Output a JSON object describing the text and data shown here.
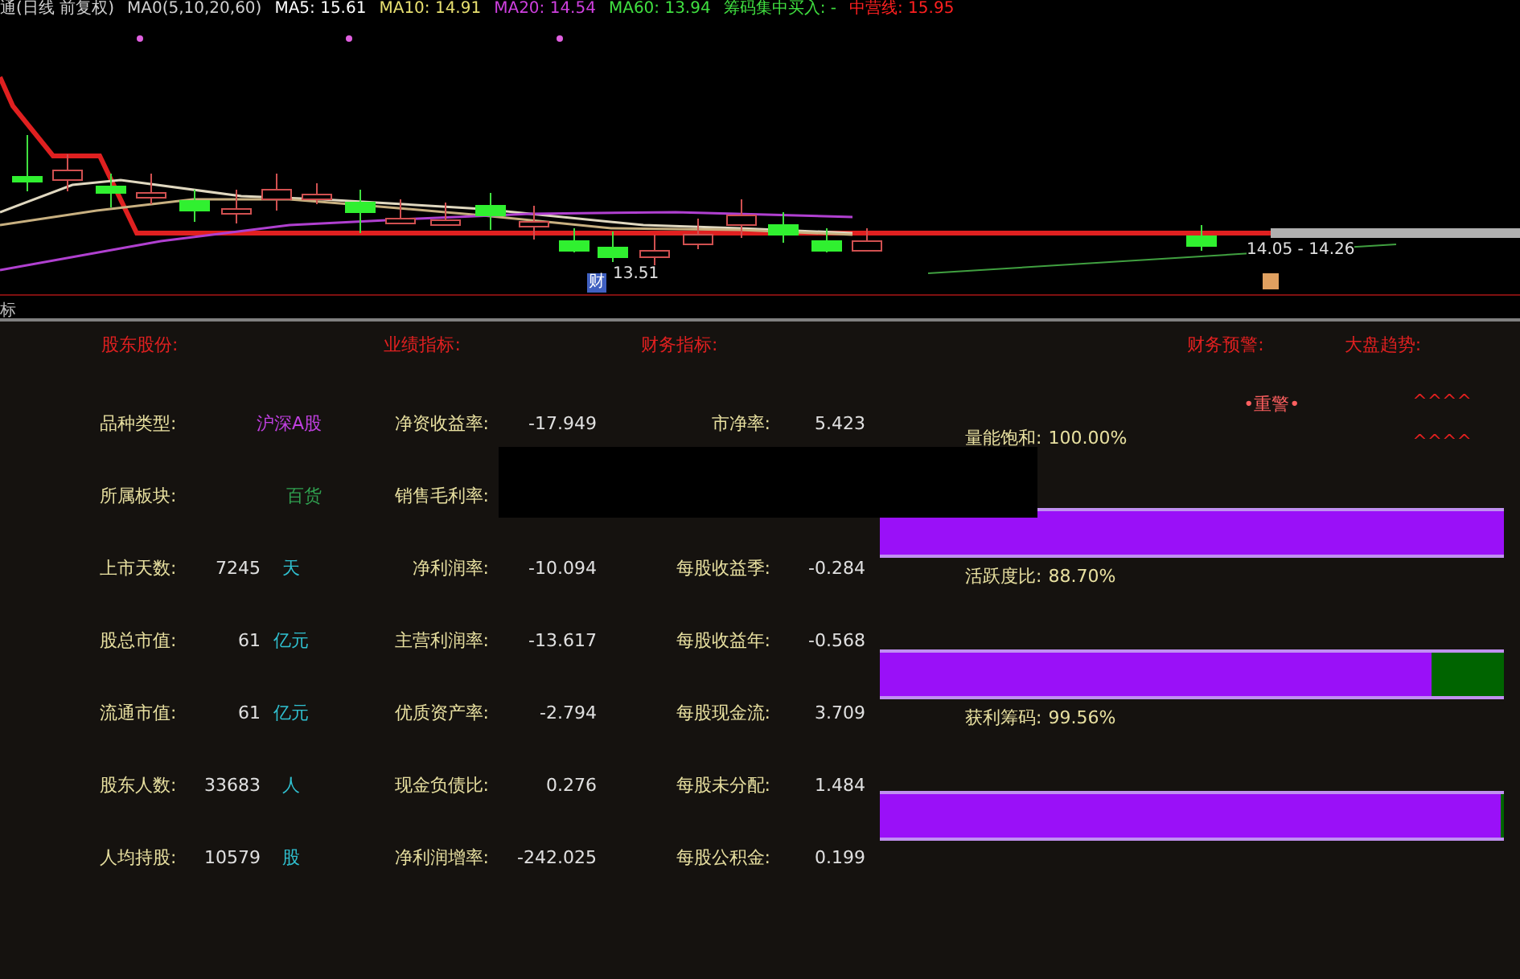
{
  "chart_header": {
    "title": "通(日线 前复权)",
    "indicator": "MA0(5,10,20,60)",
    "items": [
      {
        "text": "MA5: 15.61",
        "color": "#ffffff"
      },
      {
        "text": "MA10: 14.91",
        "color": "#e8e070"
      },
      {
        "text": "MA20: 14.54",
        "color": "#d040e0"
      },
      {
        "text": "MA60: 13.94",
        "color": "#40e040"
      },
      {
        "text": "筹码集中买入: -",
        "color": "#40e040"
      },
      {
        "text": "中营线: 15.95",
        "color": "#ff2020"
      }
    ]
  },
  "chart": {
    "low_label": "13.51",
    "range_label": "14.05 - 14.26",
    "marker": "财"
  },
  "lower_tab": "标",
  "headers": [
    {
      "text": "股东股份:"
    },
    {
      "text": "业绩指标:"
    },
    {
      "text": "财务指标:"
    },
    {
      "text": "财务预警:"
    },
    {
      "text": "大盘趋势:"
    }
  ],
  "rows": [
    {
      "basic": {
        "label": "品种类型:",
        "value": "沪深A股",
        "color": "#c040e0"
      },
      "performance": {
        "label": "净资收益率:",
        "value": "-17.949"
      },
      "finance": {
        "label": "市净率:",
        "value": "5.423"
      }
    },
    {
      "basic": {
        "label": "所属板块:",
        "value": "百货",
        "color": "#30a050"
      },
      "performance": {
        "label": "销售毛利率:"
      }
    },
    {
      "basic": {
        "label": "上市天数:",
        "value": "7245",
        "unit": "天"
      },
      "performance": {
        "label": "净利润率:",
        "value": "-10.094"
      },
      "finance": {
        "label": "每股收益季:",
        "value": "-0.284"
      }
    },
    {
      "basic": {
        "label": "股总市值:",
        "value": "61",
        "unit": "亿元"
      },
      "performance": {
        "label": "主营利润率:",
        "value": "-13.617"
      },
      "finance": {
        "label": "每股收益年:",
        "value": "-0.568"
      }
    },
    {
      "basic": {
        "label": "流通市值:",
        "value": "61",
        "unit": "亿元"
      },
      "performance": {
        "label": "优质资产率:",
        "value": "-2.794"
      },
      "finance": {
        "label": "每股现金流:",
        "value": "3.709"
      }
    },
    {
      "basic": {
        "label": "股东人数:",
        "value": "33683",
        "unit": "人"
      },
      "performance": {
        "label": "现金负债比:",
        "value": "0.276"
      },
      "finance": {
        "label": "每股未分配:",
        "value": "1.484"
      }
    },
    {
      "basic": {
        "label": "人均持股:",
        "value": "10579",
        "unit": "股"
      },
      "performance": {
        "label": "净利润增率:",
        "value": "-242.025"
      },
      "finance": {
        "label": "每股公积金:",
        "value": "0.199"
      }
    }
  ],
  "warning": "•重警•",
  "trend": [
    "^^^^",
    "^^^^"
  ],
  "meters": [
    {
      "label": "量能饱和:",
      "reading": "100.00%",
      "level": 1
    },
    {
      "label": "活跃度比:",
      "reading": "88.70%",
      "level": 0.885
    },
    {
      "label": "获利筹码:",
      "reading": "99.56%",
      "level": 0.995
    }
  ]
}
